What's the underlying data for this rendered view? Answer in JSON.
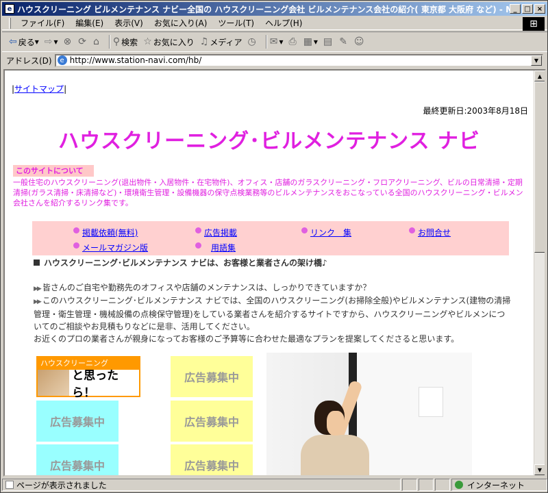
{
  "window": {
    "title": "ハウスクリーニング ビルメンテナンス ナビー全国の ハウスクリーニング会社 ビルメンテナンス会社の紹介( 東京都 大阪府 など) - Microsoft Internet Expl...",
    "controls": [
      "_",
      "□",
      "×"
    ]
  },
  "menu": [
    "ファイル(F)",
    "編集(E)",
    "表示(V)",
    "お気に入り(A)",
    "ツール(T)",
    "ヘルプ(H)"
  ],
  "toolbar": {
    "back": "戻る",
    "search": "検索",
    "favorites": "お気に入り",
    "media": "メディア"
  },
  "address": {
    "label": "アドレス(D)",
    "url": "http://www.station-navi.com/hb/"
  },
  "page": {
    "sitemap": "サイトマップ",
    "updated": "最終更新日:2003年8月18日",
    "title": "ハウスクリーニング･ビルメンテナンス ナビ",
    "about_label": "このサイトについて",
    "about_desc": "一般住宅のハウスクリーニング(退出物件・入居物件・在宅物件)、オフィス・店舗のガラスクリーニング・フロアクリーニング、ビルの日常清掃・定期清掃(ガラス清掃・床清掃など)・環境衛生管理・設備機器の保守点検業務等のビルメンテナンスをおこなっている全国のハウスクリーニング・ビルメン会社さんを紹介するリンク集です。",
    "nav": [
      "掲載依頼(無料)",
      "広告掲載",
      "リンク　集",
      "お問合せ",
      "メールマガジン版",
      "用語集"
    ],
    "tagline": "ハウスクリーニング･ビルメンテナンス ナビは、お客様と業者さんの架け橋♪",
    "para1": "皆さんのご自宅や勤務先のオフィスや店舗のメンテナンスは、しっかりできていますか？",
    "para2": "このハウスクリーニング･ビルメンテナンス ナビでは、全国のハウスクリーニング(お掃除全般)やビルメンテナンス(建物の清掃管理・衛生管理・機械設備の点検保守管理)をしている業者さんを紹介するサイトですから、ハウスクリーニングやビルメンについてのご相談やお見積もりなどに是非、活用してください。",
    "para3": "お近くのプロの業者さんが親身になってお客様のご予算等に合わせた最適なプランを提案してくださると思います。",
    "banner_top": "ハウスクリーニング",
    "banner_text": "と思ったら！",
    "ad": "広告募集中"
  },
  "status": {
    "text": "ページが表示されました",
    "zone": "インターネット"
  },
  "colors": {
    "accent": "#e020e0",
    "nav_bg": "#ffd0d0",
    "ad_yellow": "#ffff99",
    "ad_cyan": "#99ffff",
    "banner": "#ff9900"
  }
}
